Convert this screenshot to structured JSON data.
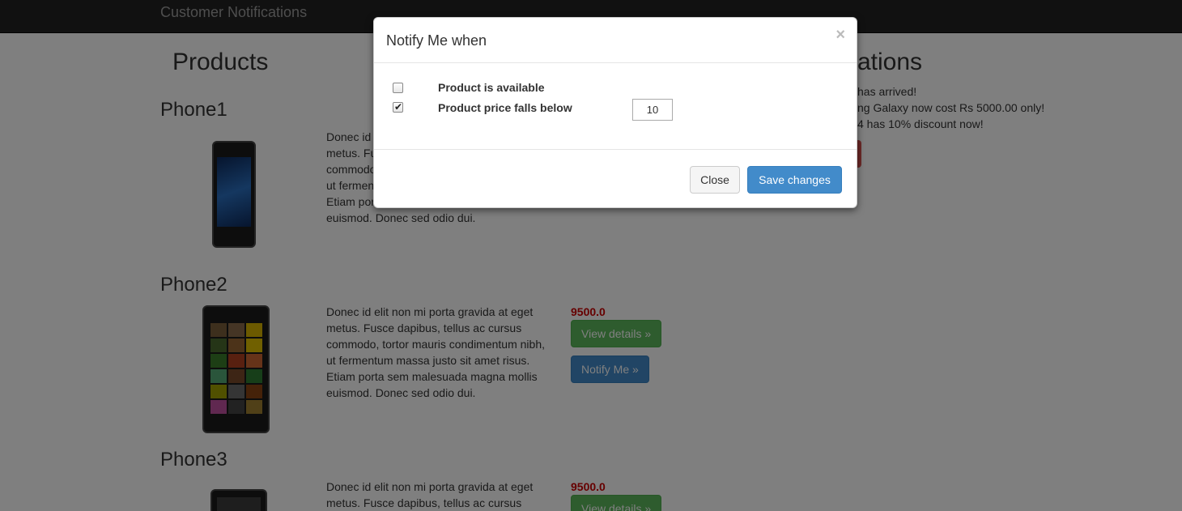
{
  "navbar": {
    "brand": "Customer Notifications"
  },
  "products_column": {
    "title": "Products"
  },
  "notifications_column": {
    "title_visible": "ations",
    "items": [
      "has arrived!",
      "ng Galaxy now cost Rs 5000.00 only!",
      "4 has 10% discount now!"
    ]
  },
  "products": [
    {
      "name": "Phone1",
      "description": "Donec id elit non mi porta gravida at eget metus. Fusce dapibus, tellus ac cursus commodo, tortor mauris condimentum nibh, ut fermentum massa justo sit amet risus. Etiam porta sem malesuada magna mollis euismod. Donec sed odio dui.",
      "description_visible": [
        "Donec id",
        "metus. Fu",
        "commodo",
        "ut fermen",
        "Etiam por",
        "euismod. Donec sed odio dui."
      ]
    },
    {
      "name": "Phone2",
      "description_lines": [
        "Donec id elit non mi porta gravida at eget",
        "metus. Fusce dapibus, tellus ac cursus",
        "commodo, tortor mauris condimentum nibh,",
        "ut fermentum massa justo sit amet risus.",
        "Etiam porta sem malesuada magna mollis",
        "euismod. Donec sed odio dui."
      ],
      "price": "9500.0",
      "view_details": "View details »",
      "notify_me": "Notify Me »"
    },
    {
      "name": "Phone3",
      "description_lines": [
        "Donec id elit non mi porta gravida at eget",
        "metus. Fusce dapibus, tellus ac cursus"
      ],
      "price": "9500.0",
      "view_details": "View details »"
    }
  ],
  "modal": {
    "title": "Notify Me when",
    "close_symbol": "×",
    "options": [
      {
        "label": "Product is available",
        "checked": false
      },
      {
        "label": "Product price falls below",
        "checked": true
      }
    ],
    "price_threshold": "10",
    "close_button": "Close",
    "save_button": "Save changes"
  },
  "colors": {
    "navbar_bg": "#222222",
    "price": "#cc0000",
    "success": "#5cb85c",
    "primary": "#428bca"
  }
}
